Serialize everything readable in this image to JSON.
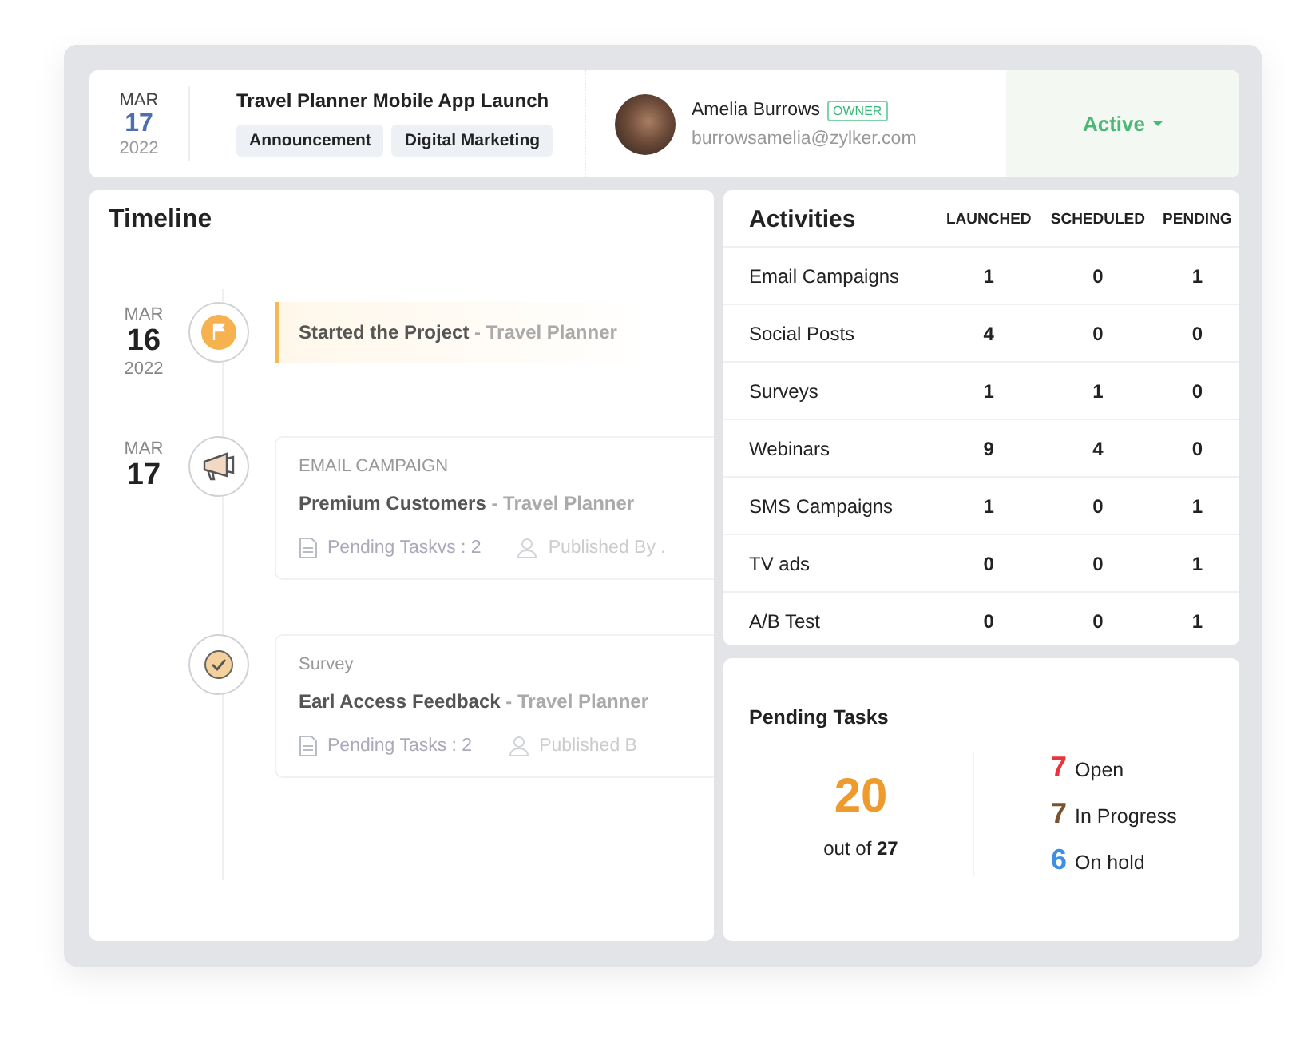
{
  "header": {
    "date": {
      "month": "MAR",
      "day": "17",
      "year": "2022"
    },
    "title": "Travel Planner Mobile App Launch",
    "tags": [
      "Announcement",
      "Digital Marketing"
    ],
    "owner": {
      "name": "Amelia Burrows",
      "badge": "OWNER",
      "email": "burrowsamelia@zylker.com"
    },
    "status": "Active"
  },
  "timeline": {
    "title": "Timeline",
    "events": [
      {
        "kind": "milestone",
        "month": "MAR",
        "day": "16",
        "year": "2022",
        "title": "Started the Project",
        "project": "- Travel Planner"
      },
      {
        "kind": "email",
        "month": "MAR",
        "day": "17",
        "category": "EMAIL CAMPAIGN",
        "title": "Premium Customers",
        "project": "- Travel Planner",
        "tasks": "Pending Taskvs : 2",
        "publisher": "Published By ."
      },
      {
        "kind": "survey",
        "category": "Survey",
        "title": "Earl Access Feedback",
        "project": "- Travel Planner",
        "tasks": "Pending Tasks : 2",
        "publisher": "Published B"
      }
    ]
  },
  "activities": {
    "title": "Activities",
    "columns": [
      "LAUNCHED",
      "SCHEDULED",
      "PENDING"
    ],
    "rows": [
      {
        "name": "Email Campaigns",
        "values": [
          "1",
          "0",
          "1"
        ]
      },
      {
        "name": "Social Posts",
        "values": [
          "4",
          "0",
          "0"
        ]
      },
      {
        "name": "Surveys",
        "values": [
          "1",
          "1",
          "0"
        ]
      },
      {
        "name": "Webinars",
        "values": [
          "9",
          "4",
          "0"
        ]
      },
      {
        "name": "SMS Campaigns",
        "values": [
          "1",
          "0",
          "1"
        ]
      },
      {
        "name": "TV ads",
        "values": [
          "0",
          "0",
          "1"
        ]
      },
      {
        "name": "A/B Test",
        "values": [
          "0",
          "0",
          "1"
        ]
      }
    ]
  },
  "pending_tasks": {
    "title": "Pending Tasks",
    "done": "20",
    "out_of_label": "out of",
    "total": "27",
    "breakdown": [
      {
        "count": "7",
        "label": "Open",
        "color": "#e8343a"
      },
      {
        "count": "7",
        "label": "In Progress",
        "color": "#7a5230"
      },
      {
        "count": "6",
        "label": "On hold",
        "color": "#3d8fe0"
      }
    ]
  }
}
